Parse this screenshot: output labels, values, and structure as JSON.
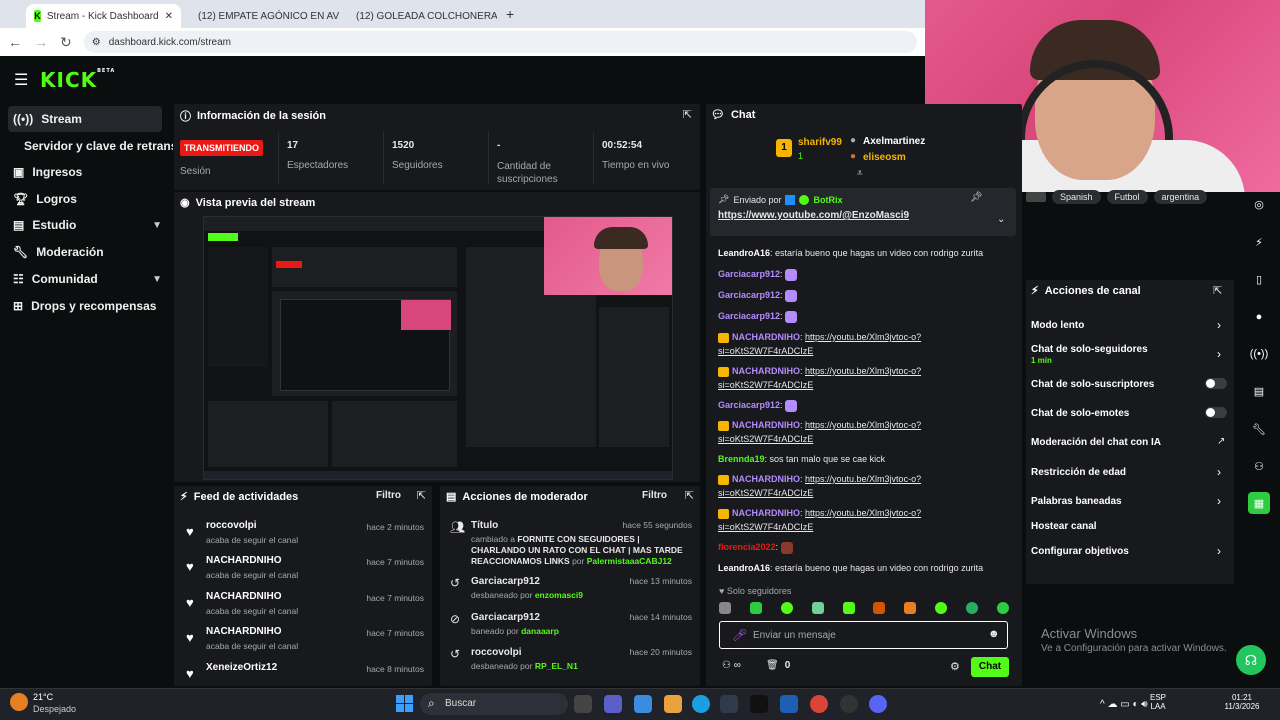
{
  "browser": {
    "tabs": [
      {
        "title": "Stream - Kick Dashboard",
        "active": true
      },
      {
        "title": "(12) EMPATE AGÓNICO EN AVE",
        "active": false
      },
      {
        "title": "(12) GOLEADA COLCHONERA...",
        "active": false
      }
    ],
    "url": "dashboard.kick.com/stream"
  },
  "logo": {
    "text": "KICK",
    "badge": "BETA"
  },
  "sidebar": {
    "items": [
      {
        "label": "Stream",
        "icon": "broadcast-icon"
      },
      {
        "label": "Servidor y clave de retransm",
        "icon": ""
      },
      {
        "label": "Ingresos",
        "icon": "wallet-icon"
      },
      {
        "label": "Logros",
        "icon": "trophy-icon"
      },
      {
        "label": "Estudio",
        "icon": "studio-icon"
      },
      {
        "label": "Moderación",
        "icon": "wrench-icon"
      },
      {
        "label": "Comunidad",
        "icon": "community-icon"
      },
      {
        "label": "Drops y recompensas",
        "icon": "gift-icon"
      }
    ]
  },
  "session": {
    "title": "Información de la sesión",
    "live_badge": "TRANSMITIENDO",
    "session_label": "Sesión",
    "stats": [
      {
        "value": "17",
        "label": "Espectadores"
      },
      {
        "value": "1520",
        "label": "Seguidores"
      },
      {
        "value": "-",
        "label": "Cantidad de suscripciones"
      },
      {
        "value": "00:52:54",
        "label": "Tiempo en vivo"
      }
    ]
  },
  "preview": {
    "title": "Vista previa del stream"
  },
  "feed": {
    "title": "Feed de actividades",
    "filter": "Filtro",
    "items": [
      {
        "user": "roccovolpi",
        "sub": "acaba de seguir el canal",
        "time": "hace 2 minutos"
      },
      {
        "user": "NACHARDNIHO",
        "sub": "acaba de seguir el canal",
        "time": "hace 7 minutos"
      },
      {
        "user": "NACHARDNIHO",
        "sub": "acaba de seguir el canal",
        "time": "hace 7 minutos"
      },
      {
        "user": "NACHARDNIHO",
        "sub": "acaba de seguir el canal",
        "time": "hace 7 minutos"
      },
      {
        "user": "XeneizeOrtiz12",
        "sub": "",
        "time": "hace 8 minutos"
      }
    ]
  },
  "modactions": {
    "title": "Acciones de moderador",
    "filter": "Filtro",
    "items": [
      {
        "title": "Título",
        "time": "hace 55 segundos",
        "prefix": "cambiado a ",
        "detail": "FORNITE CON SEGUIDORES | CHARLANDO UN RATO CON EL CHAT | MAS TARDE REACCIONAMOS LINKS",
        "by": " por ",
        "mod": "PalermistaaaCABJ12"
      },
      {
        "title": "Garciacarp912",
        "time": "hace 13 minutos",
        "prefix": "desbaneado por ",
        "detail": "",
        "by": "",
        "mod": "enzomasci9"
      },
      {
        "title": "Garciacarp912",
        "time": "hace 14 minutos",
        "prefix": "baneado por ",
        "detail": "",
        "by": "",
        "mod": "danaaarp"
      },
      {
        "title": "roccovolpi",
        "time": "hace 20 minutos",
        "prefix": "desbaneado por ",
        "detail": "",
        "by": "",
        "mod": "RP_EL_N1"
      }
    ]
  },
  "chat": {
    "title": "Chat",
    "top_gifters": [
      {
        "rank": "1",
        "name": "sharifv99",
        "count": "1"
      },
      {
        "rank": "",
        "name": "Axelmartinezr",
        "count": ""
      },
      {
        "rank": "",
        "name": "eliseosm",
        "count": ""
      }
    ],
    "pinned": {
      "sent_by": "Enviado por",
      "author": "BotRix",
      "link": "https://www.youtube.com/@EnzoMasci9"
    },
    "messages": [
      {
        "user": "LeandroA16",
        "color": "#ffffff",
        "text": "estaría bueno que hagas un video con rodrigo zurita",
        "link": ""
      },
      {
        "user": "Garciacarp912",
        "color": "#b48cff",
        "text": "",
        "link": ""
      },
      {
        "user": "Garciacarp912",
        "color": "#b48cff",
        "text": "",
        "link": ""
      },
      {
        "user": "Garciacarp912",
        "color": "#b48cff",
        "text": "",
        "link": ""
      },
      {
        "user": "NACHARDNIHO",
        "color": "#b48cff",
        "text": "",
        "link": "https://youtu.be/Xlm3jvtoc-o?si=oKtS2W7F4rADCIzE"
      },
      {
        "user": "NACHARDNIHO",
        "color": "#b48cff",
        "text": "",
        "link": "https://youtu.be/Xlm3jvtoc-o?si=oKtS2W7F4rADCIzE"
      },
      {
        "user": "Garciacarp912",
        "color": "#b48cff",
        "text": "",
        "link": ""
      },
      {
        "user": "NACHARDNIHO",
        "color": "#b48cff",
        "text": "",
        "link": "https://youtu.be/Xlm3jvtoc-o?si=oKtS2W7F4rADCIzE"
      },
      {
        "user": "Brennda19",
        "color": "#53fc18",
        "text": "sos tan malo que se cae kick",
        "link": ""
      },
      {
        "user": "NACHARDNIHO",
        "color": "#b48cff",
        "text": "",
        "link": "https://youtu.be/Xlm3jvtoc-o?si=oKtS2W7F4rADCIzE"
      },
      {
        "user": "NACHARDNIHO",
        "color": "#b48cff",
        "text": "",
        "link": "https://youtu.be/Xlm3jvtoc-o?si=oKtS2W7F4rADCIzE"
      },
      {
        "user": "florencia2022",
        "color": "#e91916",
        "text": "",
        "link": ""
      },
      {
        "user": "LeandroA16",
        "color": "#ffffff",
        "text": "estaría bueno que hagas un video con rodrigo zurita",
        "link": ""
      }
    ],
    "followers_only": "Solo seguidores",
    "input_placeholder": "Enviar un mensaje",
    "count": "0",
    "send_label": "Chat"
  },
  "stream_tags": [
    "Spanish",
    "Futbol",
    "argentina"
  ],
  "channel_actions": {
    "title": "Acciones de canal",
    "items": [
      {
        "label": "Modo lento",
        "sub": "",
        "control": "chevron"
      },
      {
        "label": "Chat de solo-seguidores",
        "sub": "1 min",
        "control": "chevron"
      },
      {
        "label": "Chat de solo-suscriptores",
        "sub": "",
        "control": "toggle"
      },
      {
        "label": "Chat de solo-emotes",
        "sub": "",
        "control": "toggle"
      },
      {
        "label": "Moderación del chat con IA",
        "sub": "",
        "control": "external"
      },
      {
        "label": "Restricción de edad",
        "sub": "",
        "control": "chevron"
      },
      {
        "label": "Palabras baneadas",
        "sub": "",
        "control": "chevron"
      },
      {
        "label": "Hostear canal",
        "sub": "",
        "control": ""
      },
      {
        "label": "Configurar objetivos",
        "sub": "",
        "control": "chevron"
      }
    ]
  },
  "windows_watermark": {
    "title": "Activar Windows",
    "sub": "Ve a Configuración para activar Windows."
  },
  "taskbar": {
    "weather_temp": "21°C",
    "weather_desc": "Despejado",
    "search": "Buscar",
    "lang": "ESP",
    "lang2": "LAA",
    "time": "01:21",
    "date": "11/3/2026"
  },
  "colors": {
    "accent": "#53fc18",
    "live": "#e91916",
    "panel": "#18191c",
    "bg": "#0b0e0f"
  }
}
